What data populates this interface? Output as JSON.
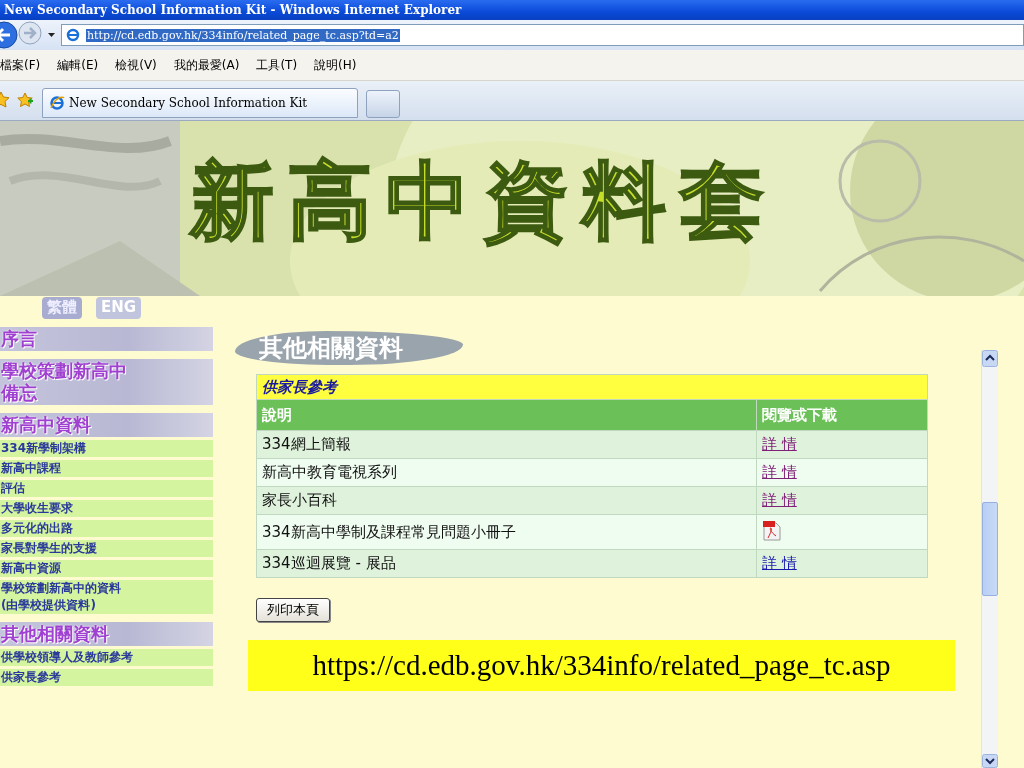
{
  "window": {
    "title": "New Secondary School Information Kit - Windows Internet Explorer"
  },
  "address_bar": {
    "url": "http://cd.edb.gov.hk/334info/related_page_tc.asp?td=a2"
  },
  "menu": [
    "檔案(F)",
    "編輯(E)",
    "檢視(V)",
    "我的最愛(A)",
    "工具(T)",
    "說明(H)"
  ],
  "tabs": [
    {
      "label": "New Secondary School Information Kit",
      "selected": true
    }
  ],
  "banner": {
    "title": "新高中資料套"
  },
  "languages": [
    {
      "label": "繁體",
      "selected": true
    },
    {
      "label": "ENG",
      "selected": false
    }
  ],
  "sidebar": {
    "sections": [
      {
        "title": "序言"
      },
      {
        "title": "學校策劃新高中備忘"
      },
      {
        "title": "新高中資料",
        "items": [
          {
            "label": "334新學制架構"
          },
          {
            "label": "新高中課程"
          },
          {
            "label": "評估"
          },
          {
            "label": "大學收生要求"
          },
          {
            "label": "多元化的出路"
          },
          {
            "label": "家長對學生的支援"
          },
          {
            "label": "新高中資源"
          },
          {
            "label": "學校策劃新高中的資料\n(由學校提供資料)"
          }
        ]
      },
      {
        "title": "其他相關資料",
        "items": [
          {
            "label": "供學校領導人及教師參考"
          },
          {
            "label": "供家長參考"
          }
        ]
      }
    ]
  },
  "page_heading": "其他相關資料",
  "table": {
    "caption": "供家長參考",
    "columns": [
      "說明",
      "閱覽或下載"
    ],
    "rows": [
      {
        "description": "334網上簡報",
        "link": {
          "kind": "text",
          "label": "詳 情",
          "visited": true
        }
      },
      {
        "description": "新高中教育電視系列",
        "link": {
          "kind": "text",
          "label": "詳 情",
          "visited": true
        }
      },
      {
        "description": "家長小百科",
        "link": {
          "kind": "text",
          "label": "詳 情",
          "visited": true
        }
      },
      {
        "description": "334新高中學制及課程常見問題小冊子",
        "link": {
          "kind": "pdf"
        }
      },
      {
        "description": "334巡迴展覽 - 展品",
        "link": {
          "kind": "text",
          "label": "詳 情",
          "visited": false
        }
      }
    ]
  },
  "print_button": "列印本頁",
  "caption": "https://cd.edb.gov.hk/334info/related_page_tc.asp"
}
